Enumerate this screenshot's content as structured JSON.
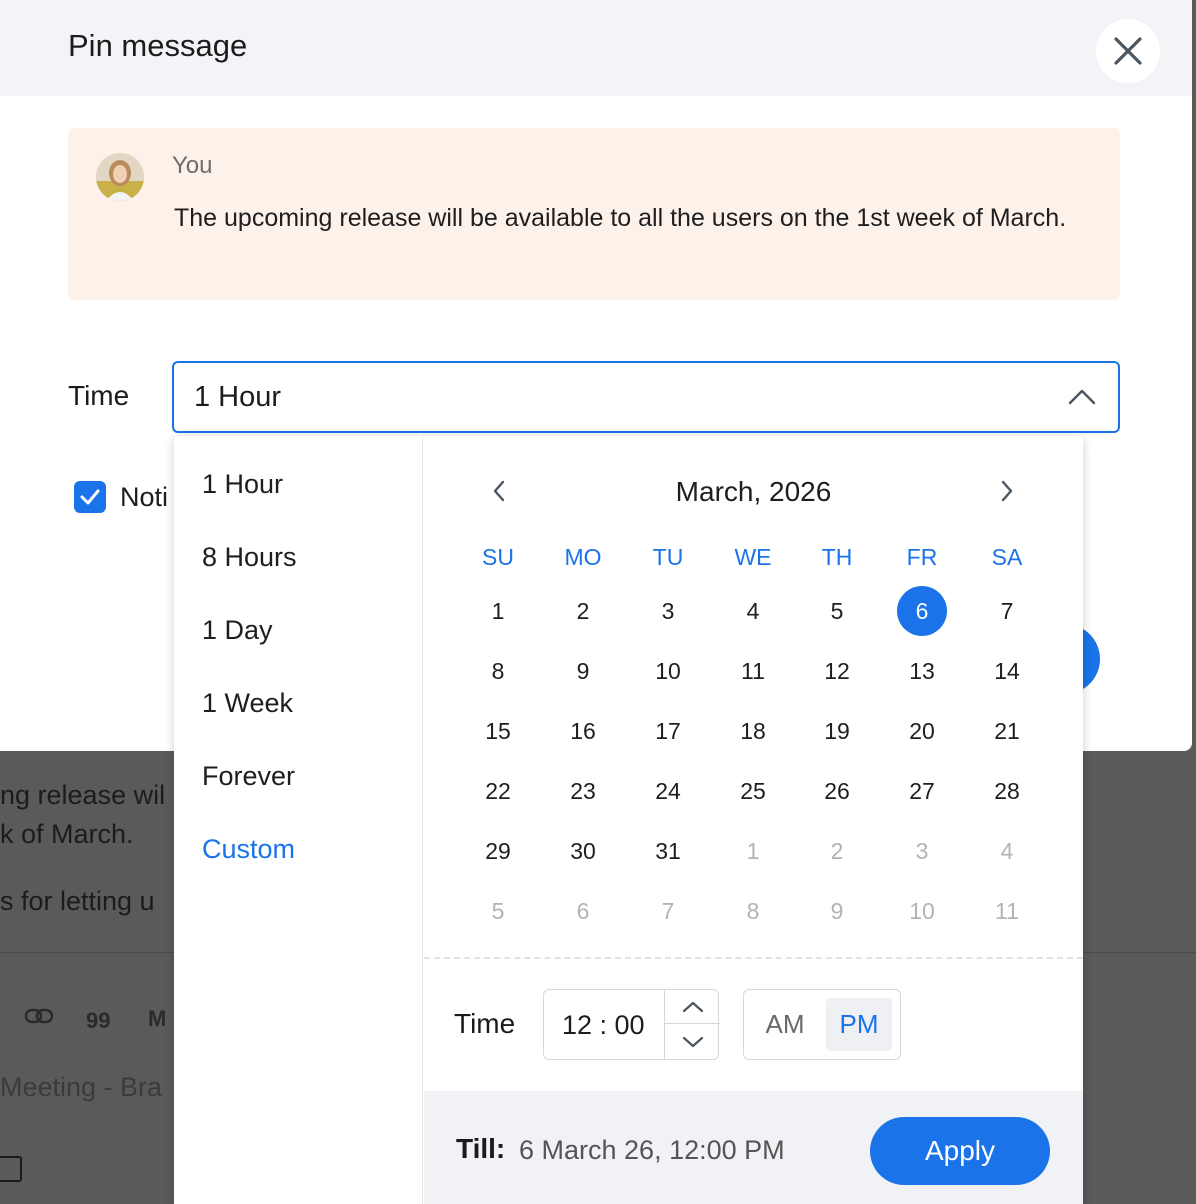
{
  "background": {
    "lines": [
      "ng release wil",
      "k of March.",
      "s for letting u"
    ],
    "toolbar_icons": [
      "link-icon",
      "quote-icon",
      "more-icon"
    ],
    "toolbar_quote": "99",
    "toolbar_m": "M",
    "placeholder": "Meeting - Bra"
  },
  "modal": {
    "title": "Pin message",
    "quote": {
      "author": "You",
      "text": "The upcoming release will be available to all the users on the 1st week of March."
    },
    "time_label": "Time",
    "time_selected": "1 Hour",
    "notify_label": "Noti",
    "notify_checked": true
  },
  "dropdown": {
    "options": [
      {
        "label": "1 Hour",
        "active": false
      },
      {
        "label": "8 Hours",
        "active": false
      },
      {
        "label": "1 Day",
        "active": false
      },
      {
        "label": "1 Week",
        "active": false
      },
      {
        "label": "Forever",
        "active": false
      },
      {
        "label": "Custom",
        "active": true
      }
    ],
    "calendar": {
      "title": "March, 2026",
      "weekdays": [
        "SU",
        "MO",
        "TU",
        "WE",
        "TH",
        "FR",
        "SA"
      ],
      "weeks": [
        [
          "1",
          "2",
          "3",
          "4",
          "5",
          "6",
          "7"
        ],
        [
          "8",
          "9",
          "10",
          "11",
          "12",
          "13",
          "14"
        ],
        [
          "15",
          "16",
          "17",
          "18",
          "19",
          "20",
          "21"
        ],
        [
          "22",
          "23",
          "24",
          "25",
          "26",
          "27",
          "28"
        ],
        [
          "29",
          "30",
          "31",
          "1",
          "2",
          "3",
          "4"
        ],
        [
          "5",
          "6",
          "7",
          "8",
          "9",
          "10",
          "11"
        ]
      ],
      "selected_day": "6",
      "time_label": "Time",
      "time_value": "12 : 00",
      "am_label": "AM",
      "pm_label": "PM",
      "meridiem": "PM",
      "till_label": "Till:",
      "till_value": "6 March 26, 12:00 PM",
      "apply_label": "Apply"
    }
  },
  "colors": {
    "accent": "#1a73e8",
    "quote_bg": "#fdf2ea",
    "header_bg": "#f3f4f7",
    "muted_day": "#b3b3b3"
  }
}
